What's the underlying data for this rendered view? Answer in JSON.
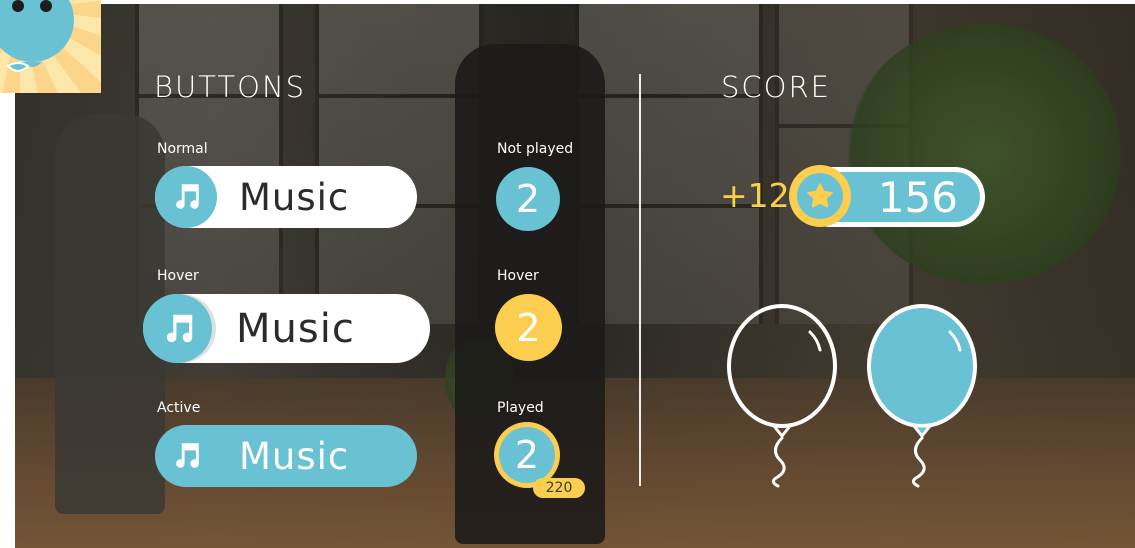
{
  "colors": {
    "accent_blue": "#68c2d4",
    "accent_yellow": "#fcce4f",
    "white": "#ffffff"
  },
  "buttons_section": {
    "title": "BUTTONS",
    "normal_label": "Normal",
    "hover_label": "Hover",
    "active_label": "Active",
    "button_text": "Music",
    "icon": "music-note-icon"
  },
  "number_section": {
    "not_played_label": "Not played",
    "hover_label": "Hover",
    "played_label": "Played",
    "value": "2",
    "played_points": "220"
  },
  "score_section": {
    "title": "SCORE",
    "increment": "+12",
    "score": "156",
    "icon": "star-icon"
  },
  "balloons": [
    {
      "style": "outline"
    },
    {
      "style": "filled"
    }
  ]
}
